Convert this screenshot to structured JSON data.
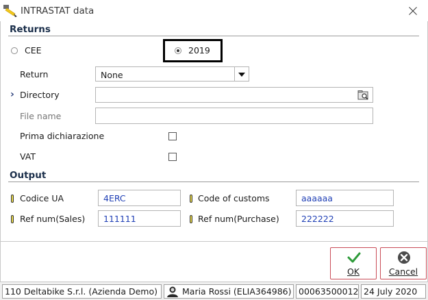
{
  "window": {
    "title": "INTRASTAT data"
  },
  "returns": {
    "section_title": "Returns",
    "radio_cee_label": "CEE",
    "radio_2019_label": "2019",
    "radio_selected": "2019",
    "return_label": "Return",
    "return_value": "None",
    "directory_label": "Directory",
    "directory_value": "",
    "file_name_label": "File name",
    "file_name_value": "",
    "prima_label": "Prima dichiarazione",
    "prima_checked": false,
    "vat_label": "VAT",
    "vat_checked": false
  },
  "output": {
    "section_title": "Output",
    "codice_ua_label": "Codice UA",
    "codice_ua_value": "4ERC",
    "code_customs_label": "Code of customs",
    "code_customs_value": "aaaaaa",
    "ref_sales_label": "Ref num(Sales)",
    "ref_sales_value": "111111",
    "ref_purchase_label": "Ref num(Purchase)",
    "ref_purchase_value": "222222"
  },
  "buttons": {
    "ok_label": "OK",
    "cancel_label": "Cancel"
  },
  "status_bar": {
    "company": "110 Deltabike S.r.l. (Azienda Demo)",
    "user": "Maria Rossi (ELIA364986)",
    "code": "00063500012",
    "date": "24 July 2020"
  },
  "colors": {
    "ok_check": "#2e9b3a",
    "cancel_icon": "#4a4a4a",
    "button_border": "#c94b56",
    "field_value_blue": "#1f3fb5"
  }
}
